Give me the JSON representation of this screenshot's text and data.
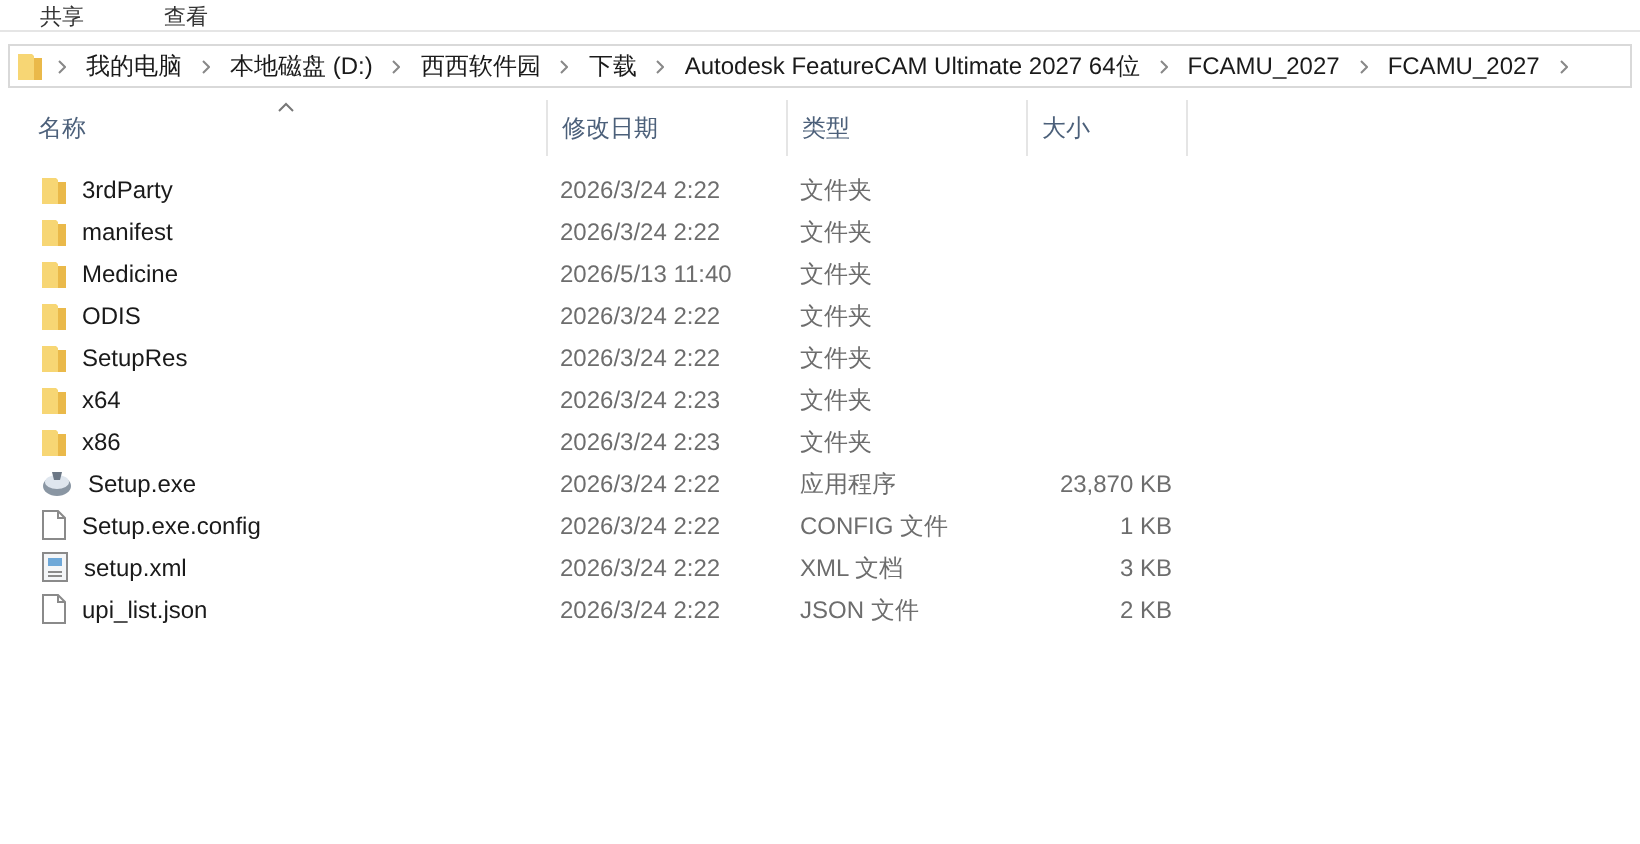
{
  "ribbon_tabs": [
    {
      "label": "共享"
    },
    {
      "label": "查看"
    }
  ],
  "breadcrumb": [
    "我的电脑",
    "本地磁盘 (D:)",
    "西西软件园",
    "下载",
    "Autodesk FeatureCAM Ultimate 2027 64位",
    "FCAMU_2027",
    "FCAMU_2027"
  ],
  "columns": [
    {
      "label": "名称",
      "sorted": true
    },
    {
      "label": "修改日期",
      "sorted": false
    },
    {
      "label": "类型",
      "sorted": false
    },
    {
      "label": "大小",
      "sorted": false
    }
  ],
  "rows": [
    {
      "kind": "folder",
      "name": "3rdParty",
      "modified": "2026/3/24 2:22",
      "type": "文件夹"
    },
    {
      "kind": "folder",
      "name": "manifest",
      "modified": "2026/3/24 2:22",
      "type": "文件夹"
    },
    {
      "kind": "folder",
      "name": "Medicine",
      "modified": "2026/5/13 11:40",
      "type": "文件夹"
    },
    {
      "kind": "folder",
      "name": "ODIS",
      "modified": "2026/3/24 2:22",
      "type": "文件夹"
    },
    {
      "kind": "folder",
      "name": "SetupRes",
      "modified": "2026/3/24 2:22",
      "type": "文件夹"
    },
    {
      "kind": "folder",
      "name": "x64",
      "modified": "2026/3/24 2:23",
      "type": "文件夹"
    },
    {
      "kind": "folder",
      "name": "x86",
      "modified": "2026/3/24 2:23",
      "type": "文件夹"
    },
    {
      "kind": "exe",
      "name": "Setup.exe",
      "modified": "2026/3/24 2:22",
      "type": "应用程序",
      "size": "23,870 KB"
    },
    {
      "kind": "file",
      "name": "Setup.exe.config",
      "modified": "2026/3/24 2:22",
      "type": "CONFIG 文件",
      "size": "1 KB"
    },
    {
      "kind": "xml",
      "name": "setup.xml",
      "modified": "2026/3/24 2:22",
      "type": "XML 文档",
      "size": "3 KB"
    },
    {
      "kind": "file",
      "name": "upi_list.json",
      "modified": "2026/3/24 2:22",
      "type": "JSON 文件",
      "size": "2 KB"
    }
  ]
}
